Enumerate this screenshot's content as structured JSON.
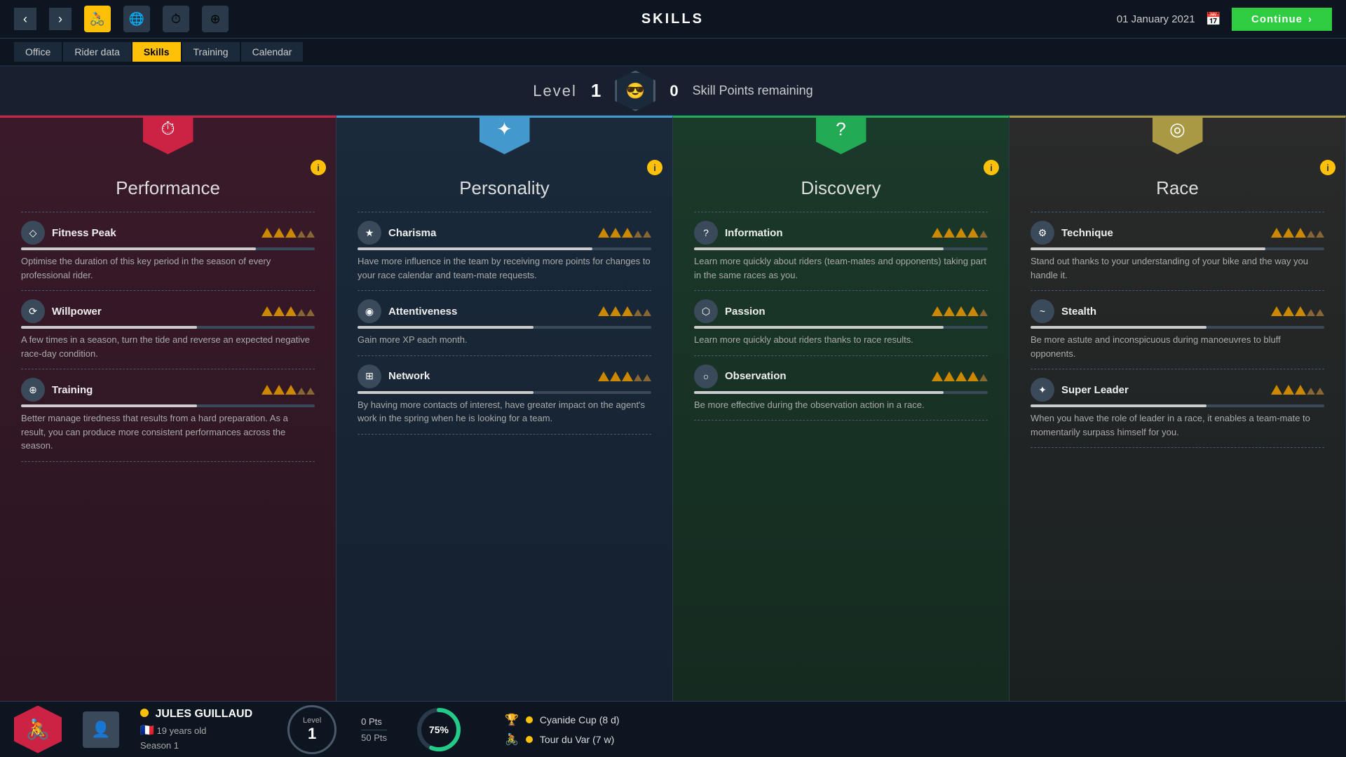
{
  "topbar": {
    "title": "SKILLS",
    "date": "01 January 2021",
    "continue_label": "Continue"
  },
  "nav": {
    "tabs": [
      "Office",
      "Rider data",
      "Skills",
      "Training",
      "Calendar"
    ],
    "active_tab": "Skills"
  },
  "level_bar": {
    "label": "Level",
    "level": "1",
    "skill_points_label": "Skill Points remaining",
    "skill_points": "0"
  },
  "cards": [
    {
      "id": "performance",
      "title": "Performance",
      "hex_color": "red",
      "icon": "⏱",
      "skills": [
        {
          "name": "Fitness Peak",
          "icon": "◇",
          "desc": "Optimise the duration of this key period in the season of every professional rider.",
          "bar": 80,
          "stars": [
            1,
            1,
            1,
            0,
            0
          ]
        },
        {
          "name": "Willpower",
          "icon": "⟳",
          "desc": "A few times in a season, turn the tide and reverse an expected negative race-day condition.",
          "bar": 60,
          "stars": [
            1,
            1,
            1,
            0,
            0
          ]
        },
        {
          "name": "Training",
          "icon": "⊕",
          "desc": "Better manage tiredness that results from a hard preparation. As a result, you can produce more consistent performances across the season.",
          "bar": 60,
          "stars": [
            1,
            1,
            1,
            0,
            0
          ]
        }
      ]
    },
    {
      "id": "personality",
      "title": "Personality",
      "hex_color": "blue",
      "icon": "✦",
      "skills": [
        {
          "name": "Charisma",
          "icon": "★",
          "desc": "Have more influence in the team by receiving more points for changes to your race calendar and team-mate requests.",
          "bar": 80,
          "stars": [
            1,
            1,
            1,
            0,
            0
          ]
        },
        {
          "name": "Attentiveness",
          "icon": "◉",
          "desc": "Gain more XP each month.",
          "bar": 60,
          "stars": [
            1,
            1,
            1,
            0,
            0
          ]
        },
        {
          "name": "Network",
          "icon": "⊞",
          "desc": "By having more contacts of interest, have greater impact on the agent's work in the spring when he is looking for a team.",
          "bar": 60,
          "stars": [
            1,
            1,
            1,
            0,
            0
          ]
        }
      ]
    },
    {
      "id": "discovery",
      "title": "Discovery",
      "hex_color": "green",
      "icon": "?",
      "skills": [
        {
          "name": "Information",
          "icon": "?",
          "desc": "Learn more quickly about riders (team-mates and opponents) taking part in the same races as you.",
          "bar": 80,
          "stars": [
            1,
            1,
            1,
            1,
            0
          ]
        },
        {
          "name": "Passion",
          "icon": "⬡",
          "desc": "Learn more quickly about riders thanks to race results.",
          "bar": 80,
          "stars": [
            1,
            1,
            1,
            1,
            0
          ]
        },
        {
          "name": "Observation",
          "icon": "○",
          "desc": "Be more effective during the observation action in a race.",
          "bar": 80,
          "stars": [
            1,
            1,
            1,
            1,
            0
          ]
        }
      ]
    },
    {
      "id": "race",
      "title": "Race",
      "hex_color": "gold",
      "icon": "◎",
      "skills": [
        {
          "name": "Technique",
          "icon": "⚙",
          "desc": "Stand out thanks to your understanding of your bike and the way you handle it.",
          "bar": 80,
          "stars": [
            1,
            1,
            1,
            0,
            0
          ]
        },
        {
          "name": "Stealth",
          "icon": "~",
          "desc": "Be more astute and inconspicuous during manoeuvres to bluff opponents.",
          "bar": 60,
          "stars": [
            1,
            1,
            1,
            0,
            0
          ]
        },
        {
          "name": "Super Leader",
          "icon": "✦",
          "desc": "When you have the role of leader in a race, it enables a team-mate to momentarily surpass himself for you.",
          "bar": 60,
          "stars": [
            1,
            1,
            1,
            0,
            0
          ]
        }
      ]
    }
  ],
  "bottom": {
    "rider_name": "JULES GUILLAUD",
    "rider_age": "19 years old",
    "rider_season": "Season 1",
    "level_label": "Level",
    "level": "1",
    "pts_current": "0 Pts",
    "pts_total": "50 Pts",
    "progress_pct": "75%",
    "races": [
      {
        "name": "Cyanide Cup",
        "detail": "(8 d)"
      },
      {
        "name": "Tour du Var",
        "detail": "(7 w)"
      }
    ]
  }
}
